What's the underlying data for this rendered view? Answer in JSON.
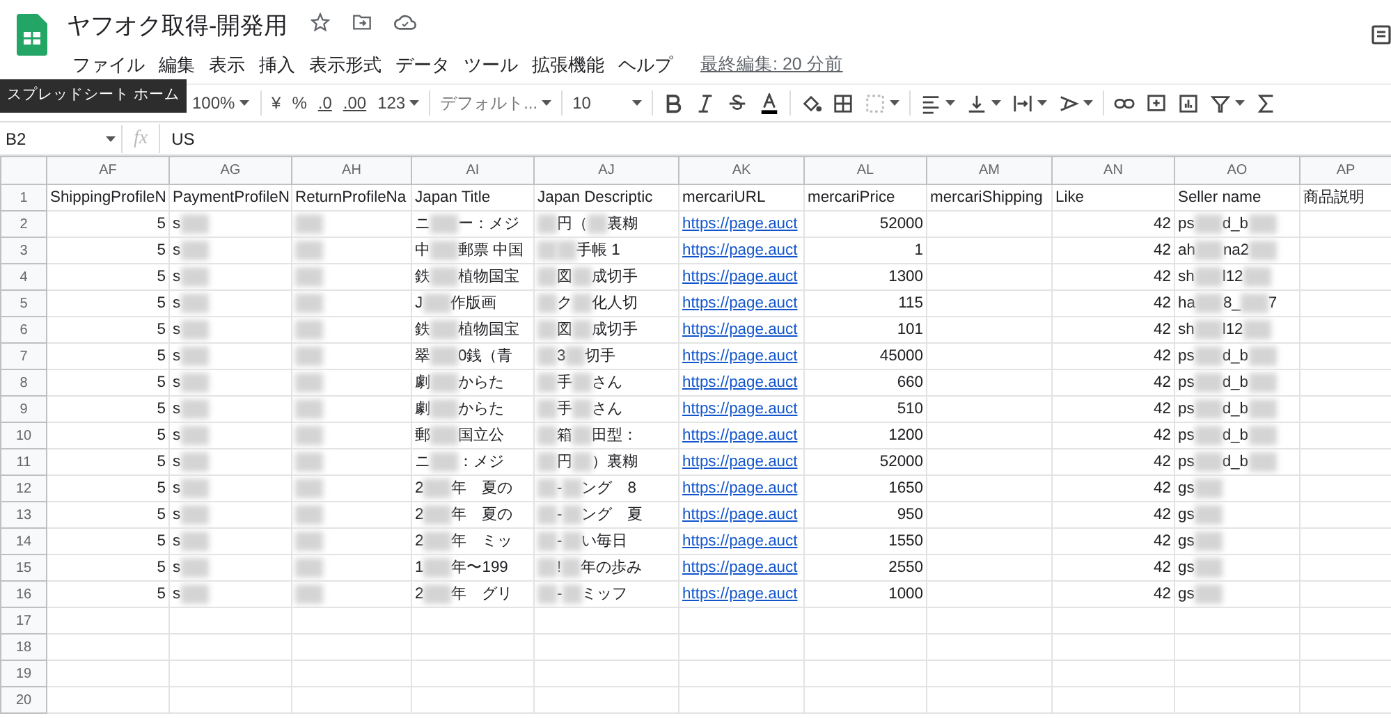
{
  "document": {
    "title": "ヤフオク取得-開発用",
    "last_edit": "最終編集: 20 分前"
  },
  "menu": [
    "ファイル",
    "編集",
    "表示",
    "挿入",
    "表示形式",
    "データ",
    "ツール",
    "拡張機能",
    "ヘルプ"
  ],
  "tooltip": "スプレッドシート ホーム",
  "toolbar": {
    "zoom": "100%",
    "currency": "¥",
    "percent": "%",
    "decrease_decimals": ".0",
    "increase_decimals": ".00",
    "number_format": "123",
    "font": "デフォルト...",
    "font_size": "10"
  },
  "formula_bar": {
    "name_box": "B2",
    "fx": "fx",
    "value": "US"
  },
  "columns": [
    {
      "letter": "AF",
      "kind": "number"
    },
    {
      "letter": "AG",
      "kind": "text"
    },
    {
      "letter": "AH",
      "kind": "text"
    },
    {
      "letter": "AI",
      "kind": "text"
    },
    {
      "letter": "AJ",
      "kind": "text"
    },
    {
      "letter": "AK",
      "kind": "link"
    },
    {
      "letter": "AL",
      "kind": "number"
    },
    {
      "letter": "AM",
      "kind": "text"
    },
    {
      "letter": "AN",
      "kind": "number"
    },
    {
      "letter": "AO",
      "kind": "text"
    },
    {
      "letter": "AP",
      "kind": "text"
    }
  ],
  "rows": [
    {
      "number": "1",
      "kind": "header",
      "cells": [
        "ShippingProfileN",
        "PaymentProfileN",
        "ReturnProfileNa",
        "Japan Title",
        "Japan Descriptic",
        "mercariURL",
        "mercariPrice",
        "mercariShipping",
        "Like",
        "Seller name",
        "商品説明"
      ]
    },
    {
      "number": "2",
      "cells": [
        "5",
        [
          "s",
          {
            "kind": "blur"
          }
        ],
        [
          {
            "kind": "blur"
          }
        ],
        [
          "ニ",
          {
            "kind": "blur"
          },
          "ー：メジ"
        ],
        [
          {
            "kind": "blur"
          },
          "円（",
          {
            "kind": "blur"
          },
          "裏糊"
        ],
        "https://page.auct",
        "52000",
        null,
        "42",
        [
          "ps",
          {
            "kind": "blur"
          },
          "d_b",
          {
            "kind": "blur"
          }
        ]
      ]
    },
    {
      "number": "3",
      "cells": [
        "5",
        [
          "s",
          {
            "kind": "blur"
          }
        ],
        [
          {
            "kind": "blur"
          }
        ],
        [
          "中",
          {
            "kind": "blur"
          },
          "郵票 中国"
        ],
        [
          {
            "kind": "blur"
          },
          {
            "kind": "blur"
          },
          "手帳 1"
        ],
        "https://page.auct",
        "1",
        null,
        "42",
        [
          "ah",
          {
            "kind": "blur"
          },
          "na2",
          {
            "kind": "blur"
          }
        ]
      ]
    },
    {
      "number": "4",
      "cells": [
        "5",
        [
          "s",
          {
            "kind": "blur"
          }
        ],
        [
          {
            "kind": "blur"
          }
        ],
        [
          "鉄",
          {
            "kind": "blur"
          },
          "植物国宝"
        ],
        [
          {
            "kind": "blur"
          },
          "図",
          {
            "kind": "blur"
          },
          "成切手"
        ],
        "https://page.auct",
        "1300",
        null,
        "42",
        [
          "sh",
          {
            "kind": "blur"
          },
          "l12",
          {
            "kind": "blur"
          }
        ]
      ]
    },
    {
      "number": "5",
      "cells": [
        "5",
        [
          "s",
          {
            "kind": "blur"
          }
        ],
        [
          {
            "kind": "blur"
          }
        ],
        [
          "J",
          {
            "kind": "blur"
          },
          "作版画"
        ],
        [
          {
            "kind": "blur"
          },
          "ク",
          {
            "kind": "blur"
          },
          "化人切"
        ],
        "https://page.auct",
        "115",
        null,
        "42",
        [
          "ha",
          {
            "kind": "blur"
          },
          "8_",
          {
            "kind": "blur"
          },
          "7"
        ]
      ]
    },
    {
      "number": "6",
      "cells": [
        "5",
        [
          "s",
          {
            "kind": "blur"
          }
        ],
        [
          {
            "kind": "blur"
          }
        ],
        [
          "鉄",
          {
            "kind": "blur"
          },
          "植物国宝"
        ],
        [
          {
            "kind": "blur"
          },
          "図",
          {
            "kind": "blur"
          },
          "成切手"
        ],
        "https://page.auct",
        "101",
        null,
        "42",
        [
          "sh",
          {
            "kind": "blur"
          },
          "l12",
          {
            "kind": "blur"
          }
        ]
      ]
    },
    {
      "number": "7",
      "cells": [
        "5",
        [
          "s",
          {
            "kind": "blur"
          }
        ],
        [
          {
            "kind": "blur"
          }
        ],
        [
          "翠",
          {
            "kind": "blur"
          },
          "0銭（青"
        ],
        [
          {
            "kind": "blur"
          },
          "3",
          {
            "kind": "blur"
          },
          "切手"
        ],
        "https://page.auct",
        "45000",
        null,
        "42",
        [
          "ps",
          {
            "kind": "blur"
          },
          "d_b",
          {
            "kind": "blur"
          }
        ]
      ]
    },
    {
      "number": "8",
      "cells": [
        "5",
        [
          "s",
          {
            "kind": "blur"
          }
        ],
        [
          {
            "kind": "blur"
          }
        ],
        [
          "劇",
          {
            "kind": "blur"
          },
          "からた"
        ],
        [
          {
            "kind": "blur"
          },
          "手",
          {
            "kind": "blur"
          },
          "さん"
        ],
        "https://page.auct",
        "660",
        null,
        "42",
        [
          "ps",
          {
            "kind": "blur"
          },
          "d_b",
          {
            "kind": "blur"
          }
        ]
      ]
    },
    {
      "number": "9",
      "cells": [
        "5",
        [
          "s",
          {
            "kind": "blur"
          }
        ],
        [
          {
            "kind": "blur"
          }
        ],
        [
          "劇",
          {
            "kind": "blur"
          },
          "からた"
        ],
        [
          {
            "kind": "blur"
          },
          "手",
          {
            "kind": "blur"
          },
          "さん"
        ],
        "https://page.auct",
        "510",
        null,
        "42",
        [
          "ps",
          {
            "kind": "blur"
          },
          "d_b",
          {
            "kind": "blur"
          }
        ]
      ]
    },
    {
      "number": "10",
      "cells": [
        "5",
        [
          "s",
          {
            "kind": "blur"
          }
        ],
        [
          {
            "kind": "blur"
          }
        ],
        [
          "郵",
          {
            "kind": "blur"
          },
          "国立公"
        ],
        [
          {
            "kind": "blur"
          },
          "箱",
          {
            "kind": "blur"
          },
          "田型："
        ],
        "https://page.auct",
        "1200",
        null,
        "42",
        [
          "ps",
          {
            "kind": "blur"
          },
          "d_b",
          {
            "kind": "blur"
          }
        ]
      ]
    },
    {
      "number": "11",
      "cells": [
        "5",
        [
          "s",
          {
            "kind": "blur"
          }
        ],
        [
          {
            "kind": "blur"
          }
        ],
        [
          "ニ",
          {
            "kind": "blur"
          },
          "：メジ"
        ],
        [
          {
            "kind": "blur"
          },
          "円",
          {
            "kind": "blur"
          },
          "）裏糊"
        ],
        "https://page.auct",
        "52000",
        null,
        "42",
        [
          "ps",
          {
            "kind": "blur"
          },
          "d_b",
          {
            "kind": "blur"
          }
        ]
      ]
    },
    {
      "number": "12",
      "cells": [
        "5",
        [
          "s",
          {
            "kind": "blur"
          }
        ],
        [
          {
            "kind": "blur"
          }
        ],
        [
          "2",
          {
            "kind": "blur"
          },
          "年　夏の"
        ],
        [
          {
            "kind": "blur"
          },
          "-",
          {
            "kind": "blur"
          },
          "ング　8"
        ],
        "https://page.auct",
        "1650",
        null,
        "42",
        [
          "gs",
          {
            "kind": "blur"
          }
        ]
      ]
    },
    {
      "number": "13",
      "cells": [
        "5",
        [
          "s",
          {
            "kind": "blur"
          }
        ],
        [
          {
            "kind": "blur"
          }
        ],
        [
          "2",
          {
            "kind": "blur"
          },
          "年　夏の"
        ],
        [
          {
            "kind": "blur"
          },
          "-",
          {
            "kind": "blur"
          },
          "ング　夏"
        ],
        "https://page.auct",
        "950",
        null,
        "42",
        [
          "gs",
          {
            "kind": "blur"
          }
        ]
      ]
    },
    {
      "number": "14",
      "cells": [
        "5",
        [
          "s",
          {
            "kind": "blur"
          }
        ],
        [
          {
            "kind": "blur"
          }
        ],
        [
          "2",
          {
            "kind": "blur"
          },
          "年　ミッ"
        ],
        [
          {
            "kind": "blur"
          },
          "-",
          {
            "kind": "blur"
          },
          "い毎日"
        ],
        "https://page.auct",
        "1550",
        null,
        "42",
        [
          "gs",
          {
            "kind": "blur"
          }
        ]
      ]
    },
    {
      "number": "15",
      "cells": [
        "5",
        [
          "s",
          {
            "kind": "blur"
          }
        ],
        [
          {
            "kind": "blur"
          }
        ],
        [
          "1",
          {
            "kind": "blur"
          },
          "年〜199"
        ],
        [
          {
            "kind": "blur"
          },
          "!",
          {
            "kind": "blur"
          },
          "年の歩み"
        ],
        "https://page.auct",
        "2550",
        null,
        "42",
        [
          "gs",
          {
            "kind": "blur"
          }
        ]
      ]
    },
    {
      "number": "16",
      "cells": [
        "5",
        [
          "s",
          {
            "kind": "blur"
          }
        ],
        [
          {
            "kind": "blur"
          }
        ],
        [
          "2",
          {
            "kind": "blur"
          },
          "年　グリ"
        ],
        [
          {
            "kind": "blur"
          },
          "-",
          {
            "kind": "blur"
          },
          "ミッフ"
        ],
        "https://page.auct",
        "1000",
        null,
        "42",
        [
          "gs",
          {
            "kind": "blur"
          }
        ]
      ]
    },
    {
      "number": "17",
      "cells": []
    },
    {
      "number": "18",
      "cells": []
    },
    {
      "number": "19",
      "cells": []
    },
    {
      "number": "20",
      "cells": []
    }
  ]
}
